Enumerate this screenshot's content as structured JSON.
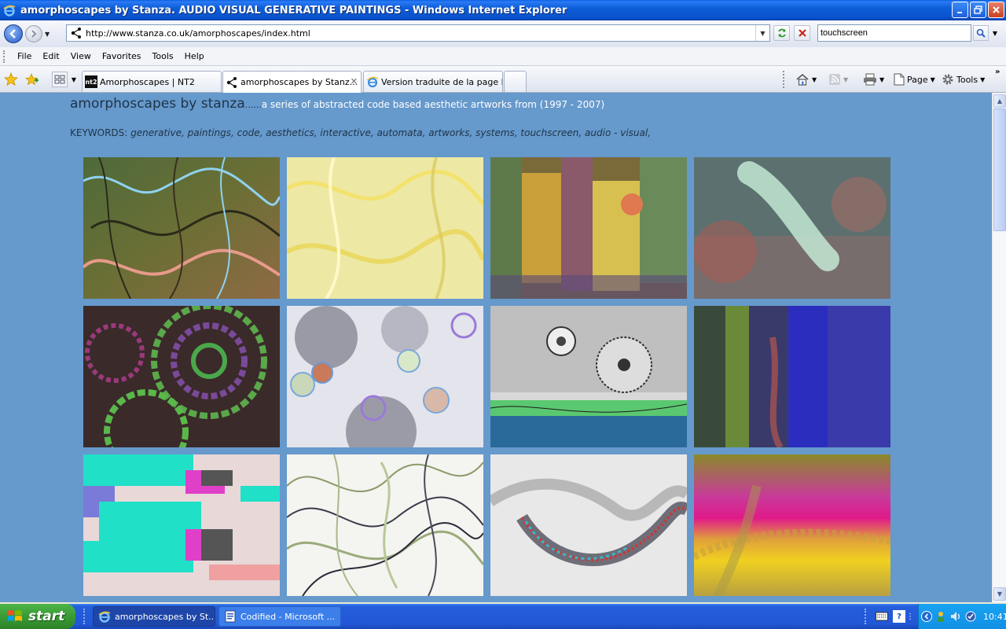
{
  "window": {
    "title": "amorphoscapes by Stanza. AUDIO VISUAL GENERATIVE PAINTINGS - Windows Internet Explorer",
    "buttons": [
      "minimize",
      "restore",
      "close"
    ]
  },
  "address_bar": {
    "url": "http://www.stanza.co.uk/amorphoscapes/index.html",
    "search_value": "touchscreen"
  },
  "menu": [
    "File",
    "Edit",
    "View",
    "Favorites",
    "Tools",
    "Help"
  ],
  "tabs": [
    {
      "label": "Amorphoscapes | NT2",
      "active": false,
      "icon_text": "nt2"
    },
    {
      "label": "amorphoscapes by Stanz...",
      "active": true
    },
    {
      "label": "Version traduite de la page h...",
      "active": false
    }
  ],
  "command_bar": {
    "page_label": "Page",
    "tools_label": "Tools"
  },
  "page": {
    "title": "amorphoscapes by stanza",
    "dots": "......",
    "subtitle": "a series of abstracted code based aesthetic artworks from (1997 - 2007)",
    "keywords_label": "KEYWORDS:",
    "keywords": "generative, paintings, code, aesthetics, interactive, automata, artworks, systems, touchscreen, audio - visual,"
  },
  "taskbar": {
    "start_label": "start",
    "tasks": [
      {
        "label": "amorphoscapes by St...",
        "active": true
      },
      {
        "label": "Codified - Microsoft ...",
        "active": false
      }
    ],
    "clock": "10:41"
  },
  "colors": {
    "content_bg": "#6699CC",
    "title_text": "#1E3347"
  }
}
